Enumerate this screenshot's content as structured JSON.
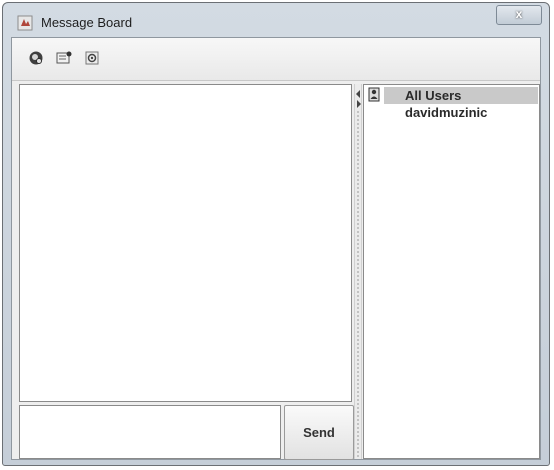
{
  "window": {
    "title": "Message Board",
    "close_label": "x"
  },
  "toolbar": {
    "buttons": [
      {
        "icon": "connect-icon"
      },
      {
        "icon": "new-message-icon"
      },
      {
        "icon": "settings-icon"
      }
    ]
  },
  "chat": {
    "message_input_value": "",
    "send_label": "Send"
  },
  "users": {
    "items": [
      {
        "label": "All Users",
        "selected": true
      },
      {
        "label": "davidmuzinic",
        "selected": false
      }
    ]
  },
  "colors": {
    "selection": "#c9c9c9",
    "title_bar": "#cfd7df"
  }
}
